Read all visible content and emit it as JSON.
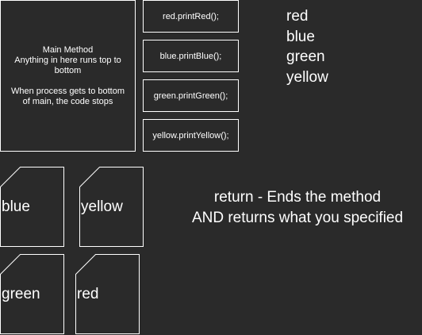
{
  "main_method": {
    "line1": "Main Method",
    "line2": "Anything in here runs top to",
    "line3": "bottom",
    "line4": "When process gets to bottom",
    "line5": "of main, the code stops"
  },
  "calls": {
    "red": "red.printRed();",
    "blue": "blue.printBlue();",
    "green": "green.printGreen();",
    "yellow": "yellow.printYellow();"
  },
  "output": [
    "red",
    "blue",
    "green",
    "yellow"
  ],
  "methods": {
    "blue": "blue",
    "yellow": "yellow",
    "green": "green",
    "red": "red"
  },
  "return_note": {
    "line1": "return - Ends the method",
    "line2": "AND returns what you specified"
  }
}
